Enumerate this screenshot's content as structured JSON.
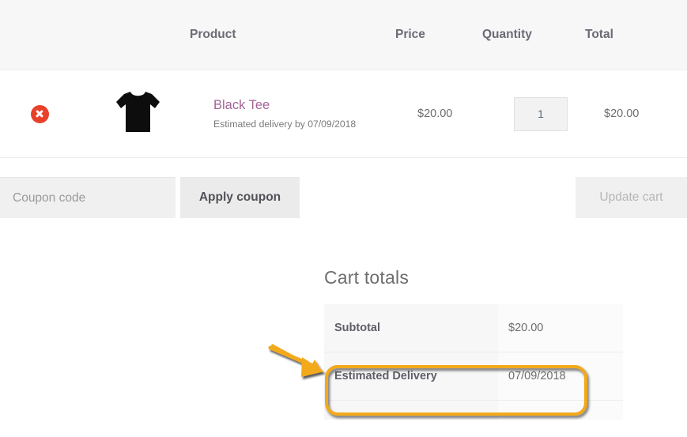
{
  "cart_table": {
    "headers": {
      "remove": "",
      "thumbnail": "",
      "product": "Product",
      "price": "Price",
      "quantity": "Quantity",
      "total": "Total"
    },
    "rows": [
      {
        "remove_label": "×",
        "thumbnail_alt": "black-tshirt-thumbnail",
        "product_name": "Black Tee",
        "product_meta": "Estimated delivery by 07/09/2018",
        "price": "$20.00",
        "quantity": "1",
        "total": "$20.00"
      }
    ]
  },
  "actions": {
    "coupon_placeholder": "Coupon code",
    "coupon_value": "",
    "apply_coupon_label": "Apply coupon",
    "update_cart_label": "Update cart"
  },
  "cart_totals": {
    "heading": "Cart totals",
    "rows": [
      {
        "label": "Subtotal",
        "value": "$20.00"
      },
      {
        "label": "Estimated Delivery",
        "value": "07/09/2018"
      }
    ]
  },
  "annotation": {
    "arrow_color": "#f2a91b",
    "highlight_color": "#f2a91b",
    "target": "Estimated Delivery"
  },
  "colors": {
    "product_link": "#a46497",
    "remove_button": "#e8412a",
    "header_background": "#f7f7f7",
    "accent": "#f2a91b"
  }
}
